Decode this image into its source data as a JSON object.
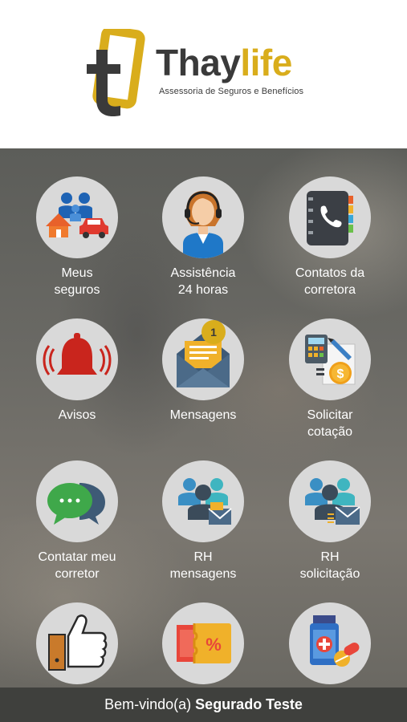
{
  "brand": {
    "name_part1": "Thay",
    "name_part2": "life",
    "tagline": "Assessoria de Seguros e Benefícios",
    "colors": {
      "dark": "#3a3a3a",
      "gold": "#d9ad1c"
    }
  },
  "menu": [
    {
      "label_line1": "Meus",
      "label_line2": "seguros",
      "icon": "family-home-car-icon"
    },
    {
      "label_line1": "Assistência",
      "label_line2": "24 horas",
      "icon": "support-agent-headset-icon"
    },
    {
      "label_line1": "Contatos da",
      "label_line2": "corretora",
      "icon": "phone-book-icon"
    },
    {
      "label_line1": "Avisos",
      "label_line2": "",
      "icon": "alarm-bell-icon"
    },
    {
      "label_line1": "Mensagens",
      "label_line2": "",
      "icon": "open-envelope-icon",
      "badge": "1"
    },
    {
      "label_line1": "Solicitar",
      "label_line2": "cotação",
      "icon": "calculator-money-icon"
    },
    {
      "label_line1": "Contatar meu",
      "label_line2": "corretor",
      "icon": "chat-bubbles-icon"
    },
    {
      "label_line1": "RH",
      "label_line2": "mensagens",
      "icon": "team-mail-icon"
    },
    {
      "label_line1": "RH",
      "label_line2": "solicitação",
      "icon": "team-request-icon"
    },
    {
      "label_line1": "",
      "label_line2": "",
      "icon": "thumbs-up-icon"
    },
    {
      "label_line1": "",
      "label_line2": "",
      "icon": "discount-ticket-icon"
    },
    {
      "label_line1": "",
      "label_line2": "",
      "icon": "medicine-icon"
    }
  ],
  "footer": {
    "greeting": "Bem-vindo(a)",
    "user_name": "Segurado Teste"
  }
}
